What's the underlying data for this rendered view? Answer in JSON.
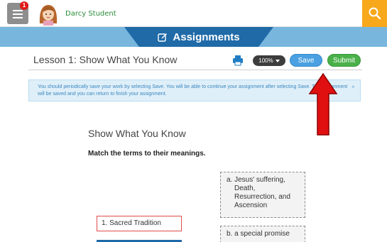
{
  "header": {
    "user_name": "Darcy Student",
    "notification_count": "1",
    "menu_icon": "hamburger-menu-icon",
    "search_icon": "search-icon"
  },
  "banner": {
    "title": "Assignments",
    "icon": "edit-icon"
  },
  "lesson": {
    "title": "Lesson 1: Show What You Know",
    "zoom_label": "100%",
    "save_label": "Save",
    "submit_label": "Submit"
  },
  "notice": {
    "text": "You should periodically save your work by selecting Save. You will be able to continue your assignment after selecting Save. The Assignment will be saved and you can return to finish your assignment.",
    "close_glyph": "×"
  },
  "content": {
    "section_title": "Show What You Know",
    "instructions": "Match the terms to their meanings.",
    "answers": [
      {
        "letter": "a.",
        "lines": [
          "Jesus' suffering,",
          "Death,",
          "Resurrection, and",
          "Ascension"
        ]
      },
      {
        "letter": "b.",
        "lines": [
          "a special promise"
        ]
      }
    ],
    "terms": [
      {
        "label": "1.  Sacred Tradition"
      }
    ]
  },
  "colors": {
    "band": "#78b6dd",
    "band_tab": "#1f6aa7",
    "save": "#4aa0e0",
    "submit": "#4ab04a",
    "accent_orange": "#f7a81b",
    "annotation_arrow": "#e01010"
  }
}
